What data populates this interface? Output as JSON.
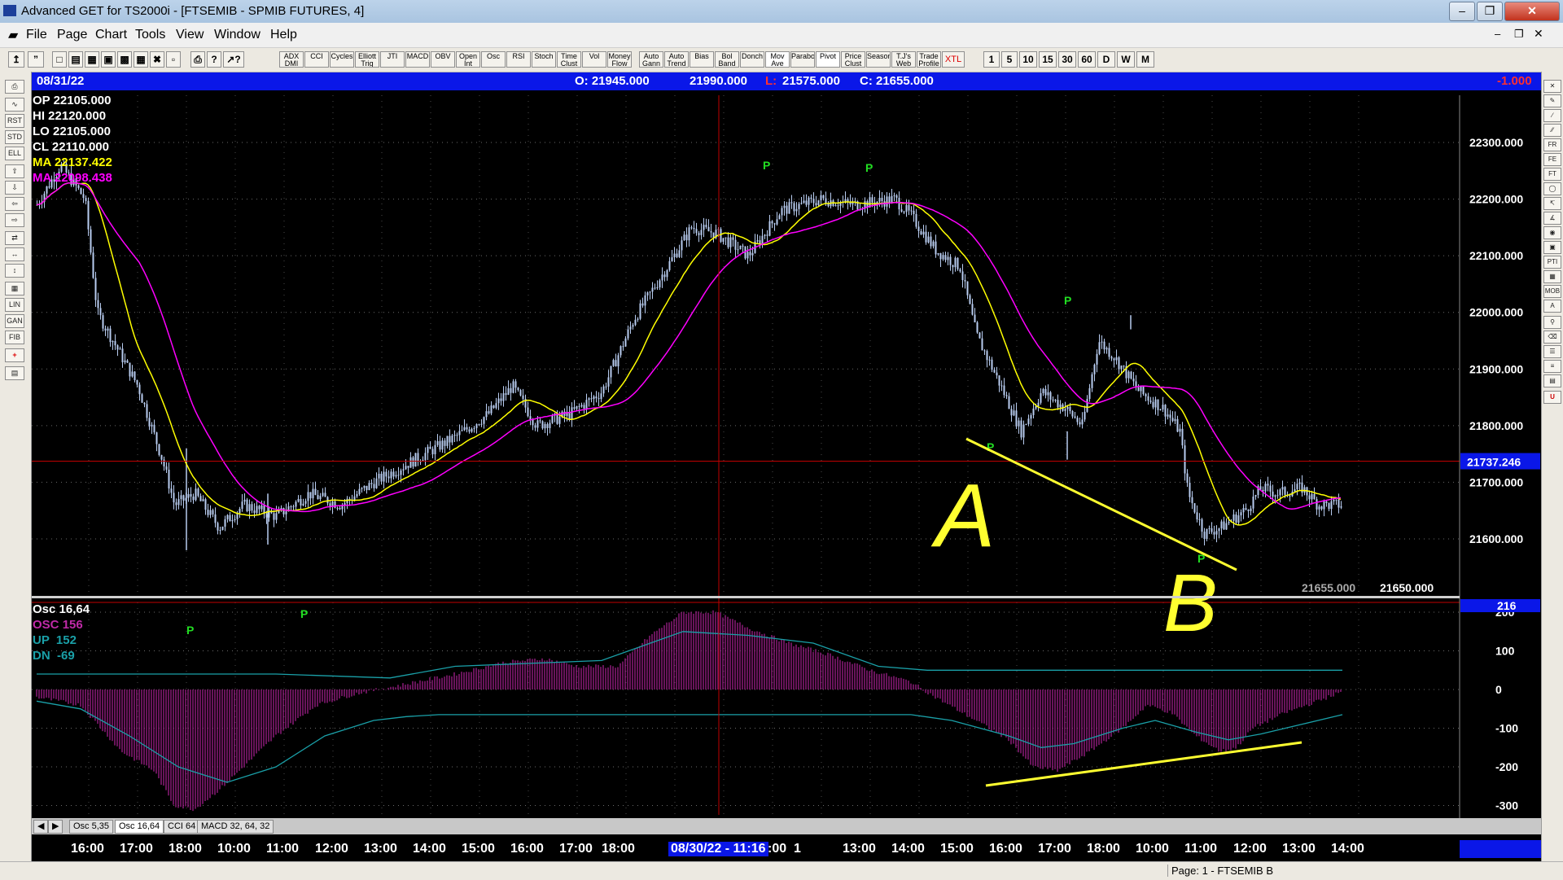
{
  "window": {
    "title": "Advanced GET for TS2000i - [FTSEMIB - SPMIB FUTURES, 4]"
  },
  "menu": [
    "File",
    "Page",
    "Chart",
    "Tools",
    "View",
    "Window",
    "Help"
  ],
  "toolbar": {
    "studies": [
      "ADX DMI",
      "CCI",
      "Cycles",
      "Elliott Trig",
      "JTI",
      "MACD",
      "OBV",
      "Open Int",
      "Osc",
      "RSI",
      "Stoch",
      "Time Clust",
      "Vol",
      "Money Flow",
      "Auto Gann",
      "Auto Trend",
      "Bias",
      "Bol Band",
      "Donch",
      "Mov Ave",
      "Parabolic",
      "Pivot",
      "Price Clust",
      "Seasonals",
      "T.J's Web",
      "Trade Profile",
      "XTL"
    ],
    "timeframes": [
      "1",
      "5",
      "10",
      "15",
      "30",
      "60",
      "D",
      "W",
      "M"
    ]
  },
  "infobar": {
    "date": "08/31/22",
    "open": "O: 21945.000",
    "high": "21990.000",
    "low_label": "L:",
    "low": "21575.000",
    "close": "C: 21655.000",
    "change": "-1.000"
  },
  "legend": [
    {
      "label": "OP",
      "value": "22105.000",
      "color": "#ffffff"
    },
    {
      "label": "HI",
      "value": "22120.000",
      "color": "#ffffff"
    },
    {
      "label": "LO",
      "value": "22105.000",
      "color": "#ffffff"
    },
    {
      "label": "CL",
      "value": "22110.000",
      "color": "#ffffff"
    },
    {
      "label": "MA",
      "value": "22137.422",
      "color": "#ffff00"
    },
    {
      "label": "MA",
      "value": "22098.438",
      "color": "#ff00ff"
    }
  ],
  "price_axis": {
    "ticks": [
      "22300.000",
      "22200.000",
      "22100.000",
      "22000.000",
      "21900.000",
      "21800.000",
      "21700.000",
      "21600.000"
    ],
    "cursor_price": "21737.246",
    "bottom_readouts": [
      "21655.000",
      "21650.000"
    ]
  },
  "osc": {
    "title": "Osc 16,64",
    "osc_label": "OSC",
    "osc_value": "156",
    "up_label": "UP",
    "up_value": "152",
    "dn_label": "DN",
    "dn_value": "-69",
    "axis_readout": "216",
    "ticks": [
      "200",
      "100",
      "0",
      "-100",
      "-200",
      "-300"
    ]
  },
  "annotations": {
    "pivot": "P",
    "wave_a": "A",
    "wave_b": "B"
  },
  "tabs": [
    "Osc 5,35",
    "Osc 16,64",
    "CCI 64",
    "MACD 32, 64, 32"
  ],
  "time_axis": {
    "labels": [
      "16:00",
      "17:00",
      "18:00",
      "10:00",
      "11:00",
      "12:00",
      "13:00",
      "14:00",
      "15:00",
      "16:00",
      "17:00",
      "18:00",
      "1",
      "13:00",
      "14:00",
      "15:00",
      "16:00",
      "17:00",
      "18:00",
      "10:00",
      "11:00",
      "12:00",
      "13:00",
      "14:00"
    ],
    "cursor": "08/30/22 - 11:16",
    "cursor_suffix": ":00"
  },
  "status": {
    "page": "Page: 1 - FTSEMIB B"
  },
  "colors": {
    "ma_fast": "#ffff00",
    "ma_slow": "#ff00ff",
    "infobar": "#0a17e8",
    "candle": "#b8ccf0",
    "osc_hist": "#a0208a",
    "osc_line": "#1aa0a8",
    "pivot": "#22dd22"
  }
}
